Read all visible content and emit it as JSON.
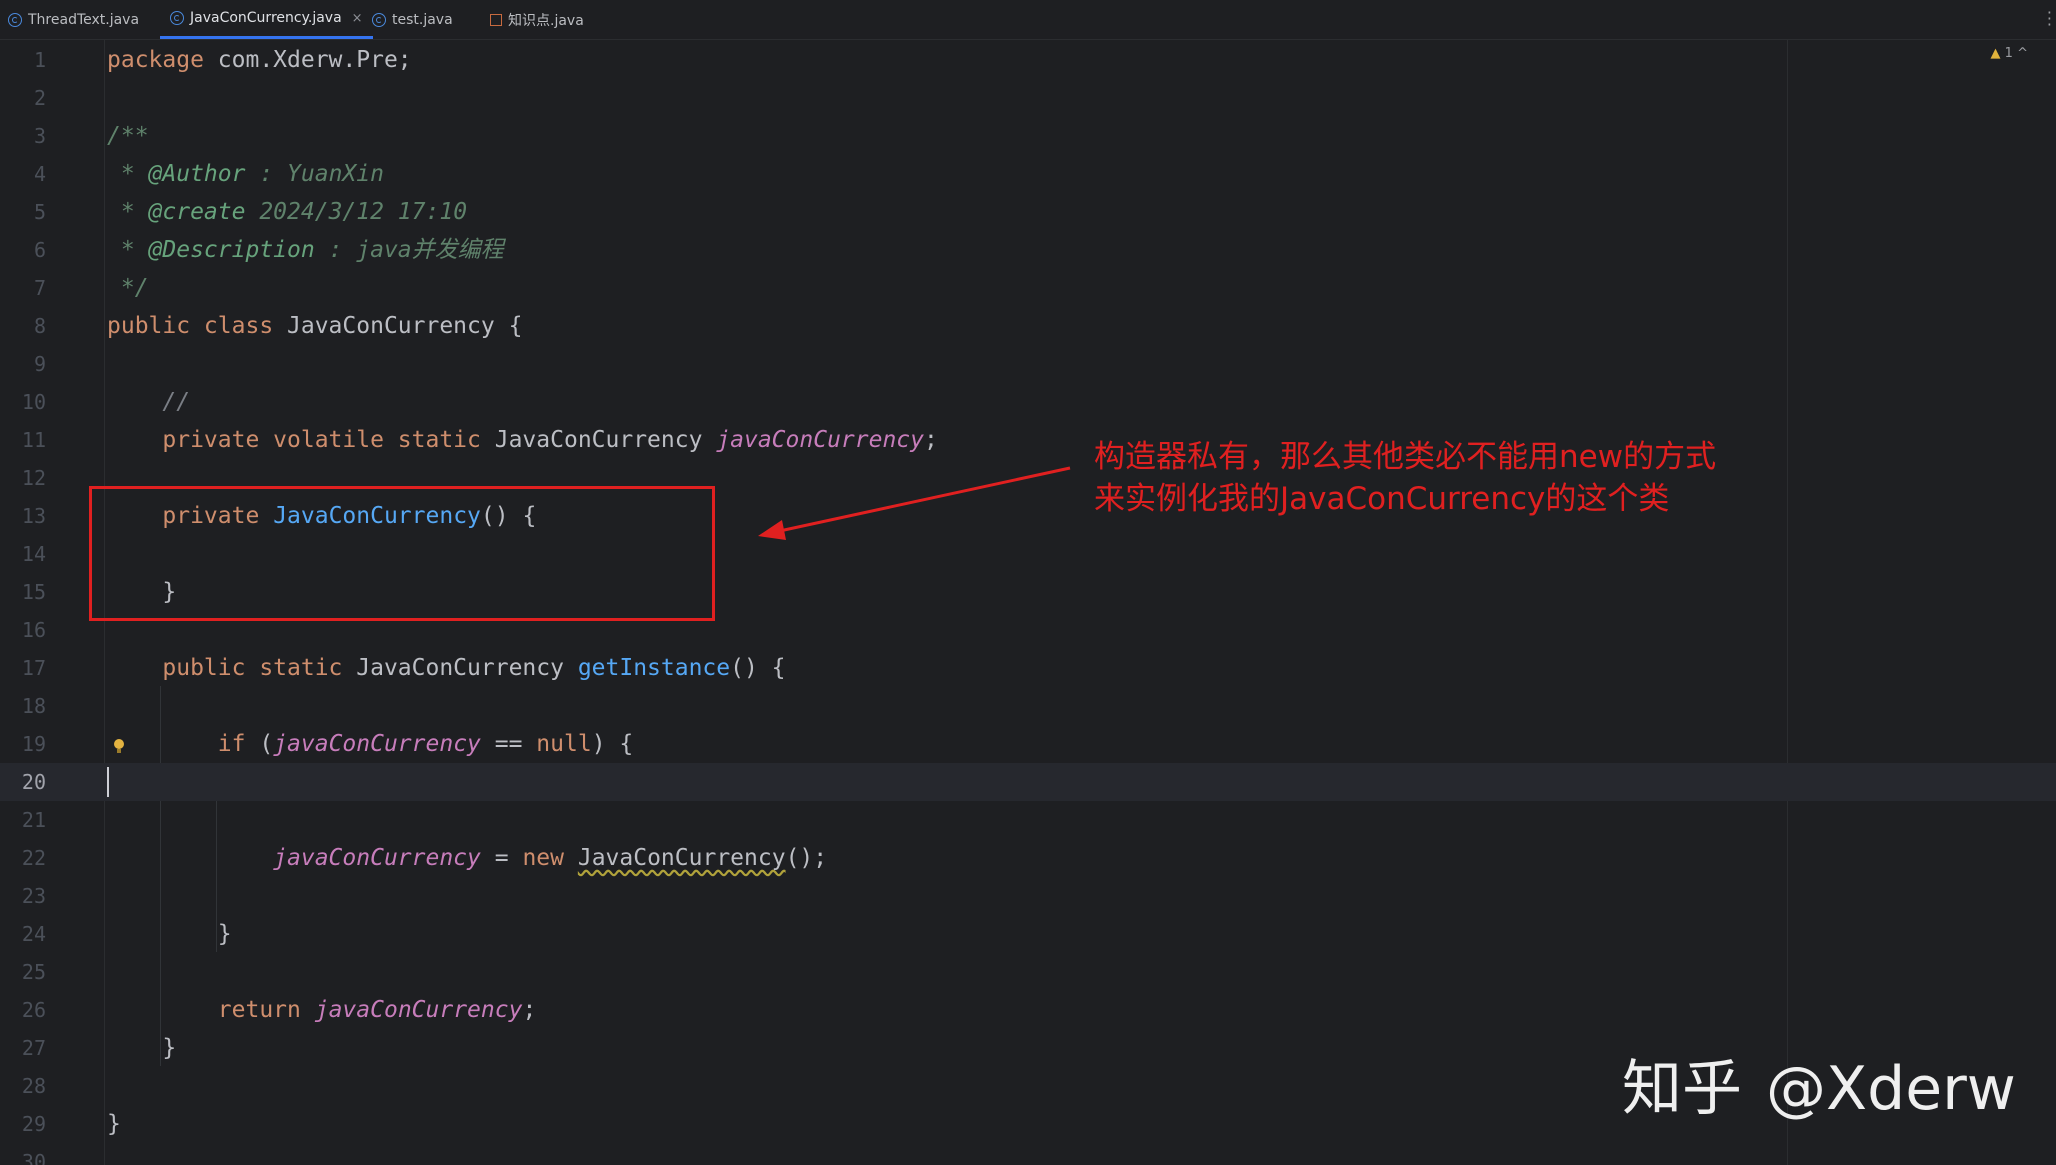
{
  "tabs": [
    {
      "label": "ThreadText.java",
      "active": false,
      "icon": "java-class-icon"
    },
    {
      "label": "JavaConCurrency.java",
      "active": true,
      "icon": "java-class-icon",
      "close": "×"
    },
    {
      "label": "test.java",
      "active": false,
      "icon": "java-class-icon"
    },
    {
      "label": "知识点.java",
      "active": false,
      "icon": "java-file-icon"
    }
  ],
  "inspection": {
    "icon": "warning-triangle-icon",
    "count": "1",
    "chevron": "^"
  },
  "editor": {
    "current_line": 20,
    "line_numbers": [
      "1",
      "2",
      "3",
      "4",
      "5",
      "6",
      "7",
      "8",
      "9",
      "10",
      "11",
      "12",
      "13",
      "14",
      "15",
      "16",
      "17",
      "18",
      "19",
      "20",
      "21",
      "22",
      "23",
      "24",
      "25",
      "26",
      "27",
      "28",
      "29",
      "30"
    ],
    "code": {
      "l1_kw": "package",
      "l1_rest": " com.Xderw.Pre;",
      "l3": "/**",
      "l4_star": " * ",
      "l4_tag": "@Author",
      "l4_rest": " : YuanXin",
      "l5_star": " * ",
      "l5_tag": "@create",
      "l5_rest": " 2024/3/12 17:10",
      "l6_star": " * ",
      "l6_tag": "@Description",
      "l6_rest": " : java并发编程",
      "l7": " */",
      "l8_kw": "public class",
      "l8_rest": " JavaConCurrency {",
      "l10": "    //",
      "l11_indent": "    ",
      "l11_kw": "private volatile static",
      "l11_type": " JavaConCurrency ",
      "l11_fld": "javaConCurrency",
      "l11_end": ";",
      "l13_indent": "    ",
      "l13_kw": "private",
      "l13_sp": " ",
      "l13_fn": "JavaConCurrency",
      "l13_end": "() {",
      "l15": "    }",
      "l17_indent": "    ",
      "l17_kw": "public static",
      "l17_type": " JavaConCurrency ",
      "l17_fn": "getInstance",
      "l17_end": "() {",
      "l19_indent": "        ",
      "l19_kw": "if",
      "l19_open": " (",
      "l19_fld": "javaConCurrency",
      "l19_op": " == ",
      "l19_null": "null",
      "l19_end": ") {",
      "l22_indent": "            ",
      "l22_fld": "javaConCurrency",
      "l22_op": " = ",
      "l22_kw": "new",
      "l22_sp": " ",
      "l22_type": "JavaConCurrency",
      "l22_end": "();",
      "l24": "        }",
      "l26_indent": "        ",
      "l26_kw": "return",
      "l26_sp": " ",
      "l26_fld": "javaConCurrency",
      "l26_end": ";",
      "l27": "    }",
      "l29": "}"
    }
  },
  "annotation": {
    "text": "构造器私有，那么其他类必不能用new的方式来实例化我的JavaConCurrency的这个类",
    "color": "#e02020"
  },
  "watermark": {
    "logo": "知乎",
    "handle": "@Xderw"
  }
}
